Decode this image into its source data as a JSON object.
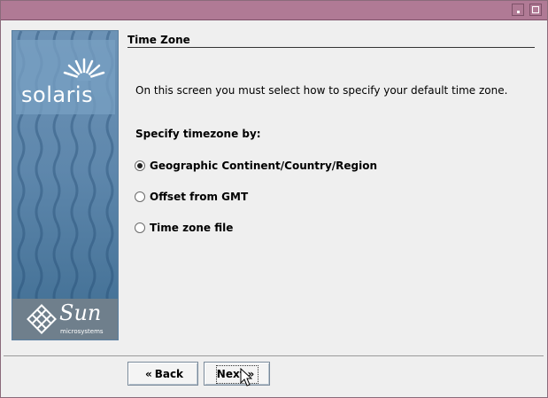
{
  "window": {
    "title": "",
    "minimize_icon": "minimize-icon",
    "maximize_icon": "maximize-icon"
  },
  "branding": {
    "product": "solaris",
    "vendor": "Sun",
    "vendor_sub": "microsystems"
  },
  "page": {
    "title": "Time Zone",
    "intro": "On this screen you must select how to specify your default time zone.",
    "question": "Specify timezone by:"
  },
  "options": [
    {
      "label": "Geographic Continent/Country/Region",
      "selected": true
    },
    {
      "label": "Offset from GMT",
      "selected": false
    },
    {
      "label": "Time zone file",
      "selected": false
    }
  ],
  "buttons": {
    "back": "Back",
    "next": "Next"
  },
  "colors": {
    "titlebar": "#b07a95",
    "side_panel": "#5e87ac",
    "background": "#efefef"
  }
}
